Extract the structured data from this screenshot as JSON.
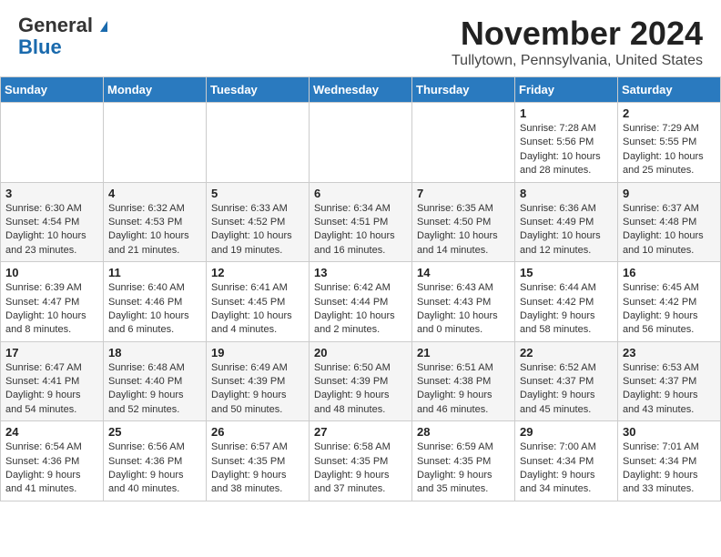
{
  "header": {
    "logo_line1": "General",
    "logo_line2": "Blue",
    "month": "November 2024",
    "location": "Tullytown, Pennsylvania, United States"
  },
  "weekdays": [
    "Sunday",
    "Monday",
    "Tuesday",
    "Wednesday",
    "Thursday",
    "Friday",
    "Saturday"
  ],
  "weeks": [
    [
      {
        "day": "",
        "info": ""
      },
      {
        "day": "",
        "info": ""
      },
      {
        "day": "",
        "info": ""
      },
      {
        "day": "",
        "info": ""
      },
      {
        "day": "",
        "info": ""
      },
      {
        "day": "1",
        "info": "Sunrise: 7:28 AM\nSunset: 5:56 PM\nDaylight: 10 hours and 28 minutes."
      },
      {
        "day": "2",
        "info": "Sunrise: 7:29 AM\nSunset: 5:55 PM\nDaylight: 10 hours and 25 minutes."
      }
    ],
    [
      {
        "day": "3",
        "info": "Sunrise: 6:30 AM\nSunset: 4:54 PM\nDaylight: 10 hours and 23 minutes."
      },
      {
        "day": "4",
        "info": "Sunrise: 6:32 AM\nSunset: 4:53 PM\nDaylight: 10 hours and 21 minutes."
      },
      {
        "day": "5",
        "info": "Sunrise: 6:33 AM\nSunset: 4:52 PM\nDaylight: 10 hours and 19 minutes."
      },
      {
        "day": "6",
        "info": "Sunrise: 6:34 AM\nSunset: 4:51 PM\nDaylight: 10 hours and 16 minutes."
      },
      {
        "day": "7",
        "info": "Sunrise: 6:35 AM\nSunset: 4:50 PM\nDaylight: 10 hours and 14 minutes."
      },
      {
        "day": "8",
        "info": "Sunrise: 6:36 AM\nSunset: 4:49 PM\nDaylight: 10 hours and 12 minutes."
      },
      {
        "day": "9",
        "info": "Sunrise: 6:37 AM\nSunset: 4:48 PM\nDaylight: 10 hours and 10 minutes."
      }
    ],
    [
      {
        "day": "10",
        "info": "Sunrise: 6:39 AM\nSunset: 4:47 PM\nDaylight: 10 hours and 8 minutes."
      },
      {
        "day": "11",
        "info": "Sunrise: 6:40 AM\nSunset: 4:46 PM\nDaylight: 10 hours and 6 minutes."
      },
      {
        "day": "12",
        "info": "Sunrise: 6:41 AM\nSunset: 4:45 PM\nDaylight: 10 hours and 4 minutes."
      },
      {
        "day": "13",
        "info": "Sunrise: 6:42 AM\nSunset: 4:44 PM\nDaylight: 10 hours and 2 minutes."
      },
      {
        "day": "14",
        "info": "Sunrise: 6:43 AM\nSunset: 4:43 PM\nDaylight: 10 hours and 0 minutes."
      },
      {
        "day": "15",
        "info": "Sunrise: 6:44 AM\nSunset: 4:42 PM\nDaylight: 9 hours and 58 minutes."
      },
      {
        "day": "16",
        "info": "Sunrise: 6:45 AM\nSunset: 4:42 PM\nDaylight: 9 hours and 56 minutes."
      }
    ],
    [
      {
        "day": "17",
        "info": "Sunrise: 6:47 AM\nSunset: 4:41 PM\nDaylight: 9 hours and 54 minutes."
      },
      {
        "day": "18",
        "info": "Sunrise: 6:48 AM\nSunset: 4:40 PM\nDaylight: 9 hours and 52 minutes."
      },
      {
        "day": "19",
        "info": "Sunrise: 6:49 AM\nSunset: 4:39 PM\nDaylight: 9 hours and 50 minutes."
      },
      {
        "day": "20",
        "info": "Sunrise: 6:50 AM\nSunset: 4:39 PM\nDaylight: 9 hours and 48 minutes."
      },
      {
        "day": "21",
        "info": "Sunrise: 6:51 AM\nSunset: 4:38 PM\nDaylight: 9 hours and 46 minutes."
      },
      {
        "day": "22",
        "info": "Sunrise: 6:52 AM\nSunset: 4:37 PM\nDaylight: 9 hours and 45 minutes."
      },
      {
        "day": "23",
        "info": "Sunrise: 6:53 AM\nSunset: 4:37 PM\nDaylight: 9 hours and 43 minutes."
      }
    ],
    [
      {
        "day": "24",
        "info": "Sunrise: 6:54 AM\nSunset: 4:36 PM\nDaylight: 9 hours and 41 minutes."
      },
      {
        "day": "25",
        "info": "Sunrise: 6:56 AM\nSunset: 4:36 PM\nDaylight: 9 hours and 40 minutes."
      },
      {
        "day": "26",
        "info": "Sunrise: 6:57 AM\nSunset: 4:35 PM\nDaylight: 9 hours and 38 minutes."
      },
      {
        "day": "27",
        "info": "Sunrise: 6:58 AM\nSunset: 4:35 PM\nDaylight: 9 hours and 37 minutes."
      },
      {
        "day": "28",
        "info": "Sunrise: 6:59 AM\nSunset: 4:35 PM\nDaylight: 9 hours and 35 minutes."
      },
      {
        "day": "29",
        "info": "Sunrise: 7:00 AM\nSunset: 4:34 PM\nDaylight: 9 hours and 34 minutes."
      },
      {
        "day": "30",
        "info": "Sunrise: 7:01 AM\nSunset: 4:34 PM\nDaylight: 9 hours and 33 minutes."
      }
    ]
  ]
}
